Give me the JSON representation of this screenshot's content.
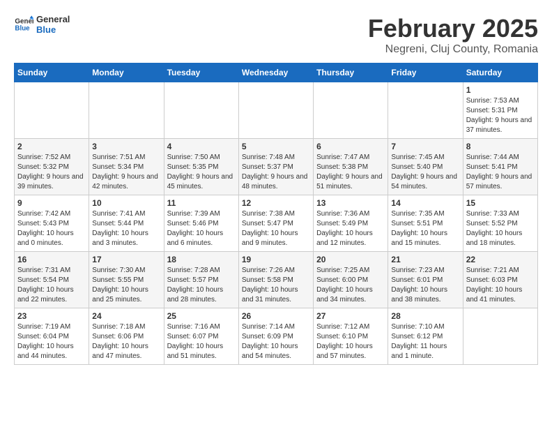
{
  "header": {
    "logo_line1": "General",
    "logo_line2": "Blue",
    "title": "February 2025",
    "subtitle": "Negreni, Cluj County, Romania"
  },
  "calendar": {
    "days_of_week": [
      "Sunday",
      "Monday",
      "Tuesday",
      "Wednesday",
      "Thursday",
      "Friday",
      "Saturday"
    ],
    "weeks": [
      [
        {
          "day": "",
          "info": ""
        },
        {
          "day": "",
          "info": ""
        },
        {
          "day": "",
          "info": ""
        },
        {
          "day": "",
          "info": ""
        },
        {
          "day": "",
          "info": ""
        },
        {
          "day": "",
          "info": ""
        },
        {
          "day": "1",
          "info": "Sunrise: 7:53 AM\nSunset: 5:31 PM\nDaylight: 9 hours and 37 minutes."
        }
      ],
      [
        {
          "day": "2",
          "info": "Sunrise: 7:52 AM\nSunset: 5:32 PM\nDaylight: 9 hours and 39 minutes."
        },
        {
          "day": "3",
          "info": "Sunrise: 7:51 AM\nSunset: 5:34 PM\nDaylight: 9 hours and 42 minutes."
        },
        {
          "day": "4",
          "info": "Sunrise: 7:50 AM\nSunset: 5:35 PM\nDaylight: 9 hours and 45 minutes."
        },
        {
          "day": "5",
          "info": "Sunrise: 7:48 AM\nSunset: 5:37 PM\nDaylight: 9 hours and 48 minutes."
        },
        {
          "day": "6",
          "info": "Sunrise: 7:47 AM\nSunset: 5:38 PM\nDaylight: 9 hours and 51 minutes."
        },
        {
          "day": "7",
          "info": "Sunrise: 7:45 AM\nSunset: 5:40 PM\nDaylight: 9 hours and 54 minutes."
        },
        {
          "day": "8",
          "info": "Sunrise: 7:44 AM\nSunset: 5:41 PM\nDaylight: 9 hours and 57 minutes."
        }
      ],
      [
        {
          "day": "9",
          "info": "Sunrise: 7:42 AM\nSunset: 5:43 PM\nDaylight: 10 hours and 0 minutes."
        },
        {
          "day": "10",
          "info": "Sunrise: 7:41 AM\nSunset: 5:44 PM\nDaylight: 10 hours and 3 minutes."
        },
        {
          "day": "11",
          "info": "Sunrise: 7:39 AM\nSunset: 5:46 PM\nDaylight: 10 hours and 6 minutes."
        },
        {
          "day": "12",
          "info": "Sunrise: 7:38 AM\nSunset: 5:47 PM\nDaylight: 10 hours and 9 minutes."
        },
        {
          "day": "13",
          "info": "Sunrise: 7:36 AM\nSunset: 5:49 PM\nDaylight: 10 hours and 12 minutes."
        },
        {
          "day": "14",
          "info": "Sunrise: 7:35 AM\nSunset: 5:51 PM\nDaylight: 10 hours and 15 minutes."
        },
        {
          "day": "15",
          "info": "Sunrise: 7:33 AM\nSunset: 5:52 PM\nDaylight: 10 hours and 18 minutes."
        }
      ],
      [
        {
          "day": "16",
          "info": "Sunrise: 7:31 AM\nSunset: 5:54 PM\nDaylight: 10 hours and 22 minutes."
        },
        {
          "day": "17",
          "info": "Sunrise: 7:30 AM\nSunset: 5:55 PM\nDaylight: 10 hours and 25 minutes."
        },
        {
          "day": "18",
          "info": "Sunrise: 7:28 AM\nSunset: 5:57 PM\nDaylight: 10 hours and 28 minutes."
        },
        {
          "day": "19",
          "info": "Sunrise: 7:26 AM\nSunset: 5:58 PM\nDaylight: 10 hours and 31 minutes."
        },
        {
          "day": "20",
          "info": "Sunrise: 7:25 AM\nSunset: 6:00 PM\nDaylight: 10 hours and 34 minutes."
        },
        {
          "day": "21",
          "info": "Sunrise: 7:23 AM\nSunset: 6:01 PM\nDaylight: 10 hours and 38 minutes."
        },
        {
          "day": "22",
          "info": "Sunrise: 7:21 AM\nSunset: 6:03 PM\nDaylight: 10 hours and 41 minutes."
        }
      ],
      [
        {
          "day": "23",
          "info": "Sunrise: 7:19 AM\nSunset: 6:04 PM\nDaylight: 10 hours and 44 minutes."
        },
        {
          "day": "24",
          "info": "Sunrise: 7:18 AM\nSunset: 6:06 PM\nDaylight: 10 hours and 47 minutes."
        },
        {
          "day": "25",
          "info": "Sunrise: 7:16 AM\nSunset: 6:07 PM\nDaylight: 10 hours and 51 minutes."
        },
        {
          "day": "26",
          "info": "Sunrise: 7:14 AM\nSunset: 6:09 PM\nDaylight: 10 hours and 54 minutes."
        },
        {
          "day": "27",
          "info": "Sunrise: 7:12 AM\nSunset: 6:10 PM\nDaylight: 10 hours and 57 minutes."
        },
        {
          "day": "28",
          "info": "Sunrise: 7:10 AM\nSunset: 6:12 PM\nDaylight: 11 hours and 1 minute."
        },
        {
          "day": "",
          "info": ""
        }
      ]
    ]
  }
}
